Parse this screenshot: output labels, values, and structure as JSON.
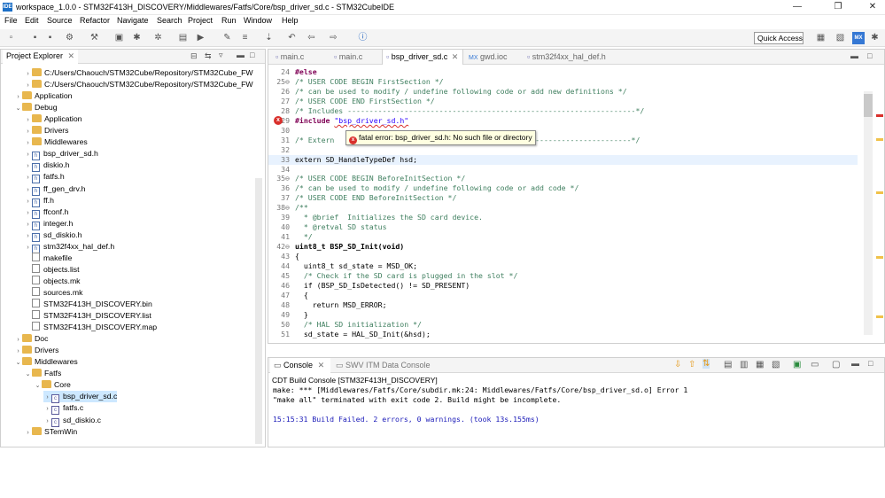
{
  "window": {
    "app_icon": "IDE",
    "title": "workspace_1.0.0 - STM32F413H_DISCOVERY/Middlewares/Fatfs/Core/bsp_driver_sd.c - STM32CubeIDE",
    "minimize": "—",
    "restore": "❐",
    "close": "✕"
  },
  "menu": [
    "File",
    "Edit",
    "Source",
    "Refactor",
    "Navigate",
    "Search",
    "Project",
    "Run",
    "Window",
    "Help"
  ],
  "toolbar": {
    "quick_access": "Quick Access",
    "perspective_mx": "MX"
  },
  "project_explorer": {
    "title": "Project Explorer",
    "tree": [
      {
        "label": "C:/Users/Chaouch/STM32Cube/Repository/STM32Cube_FW",
        "type": "folder",
        "depth": 2,
        "toggle": "›"
      },
      {
        "label": "C:/Users/Chaouch/STM32Cube/Repository/STM32Cube_FW",
        "type": "folder",
        "depth": 2,
        "toggle": "›"
      },
      {
        "label": "Application",
        "type": "folder",
        "depth": 1,
        "toggle": "›"
      },
      {
        "label": "Debug",
        "type": "folder",
        "depth": 1,
        "toggle": "⌄"
      },
      {
        "label": "Application",
        "type": "folder",
        "depth": 2,
        "toggle": "›"
      },
      {
        "label": "Drivers",
        "type": "folder",
        "depth": 2,
        "toggle": "›"
      },
      {
        "label": "Middlewares",
        "type": "folder",
        "depth": 2,
        "toggle": "›"
      },
      {
        "label": "bsp_driver_sd.h",
        "type": "h",
        "depth": 2,
        "toggle": "›"
      },
      {
        "label": "diskio.h",
        "type": "h",
        "depth": 2,
        "toggle": "›"
      },
      {
        "label": "fatfs.h",
        "type": "h",
        "depth": 2,
        "toggle": "›"
      },
      {
        "label": "ff_gen_drv.h",
        "type": "h",
        "depth": 2,
        "toggle": "›"
      },
      {
        "label": "ff.h",
        "type": "h",
        "depth": 2,
        "toggle": "›"
      },
      {
        "label": "ffconf.h",
        "type": "h",
        "depth": 2,
        "toggle": "›"
      },
      {
        "label": "integer.h",
        "type": "h",
        "depth": 2,
        "toggle": "›"
      },
      {
        "label": "sd_diskio.h",
        "type": "h",
        "depth": 2,
        "toggle": "›"
      },
      {
        "label": "stm32f4xx_hal_def.h",
        "type": "h",
        "depth": 2,
        "toggle": "›"
      },
      {
        "label": "makefile",
        "type": "file",
        "depth": 2,
        "toggle": ""
      },
      {
        "label": "objects.list",
        "type": "file",
        "depth": 2,
        "toggle": ""
      },
      {
        "label": "objects.mk",
        "type": "file",
        "depth": 2,
        "toggle": ""
      },
      {
        "label": "sources.mk",
        "type": "file",
        "depth": 2,
        "toggle": ""
      },
      {
        "label": "STM32F413H_DISCOVERY.bin",
        "type": "file",
        "depth": 2,
        "toggle": ""
      },
      {
        "label": "STM32F413H_DISCOVERY.list",
        "type": "file",
        "depth": 2,
        "toggle": ""
      },
      {
        "label": "STM32F413H_DISCOVERY.map",
        "type": "file",
        "depth": 2,
        "toggle": ""
      },
      {
        "label": "Doc",
        "type": "folder",
        "depth": 1,
        "toggle": "›"
      },
      {
        "label": "Drivers",
        "type": "folder",
        "depth": 1,
        "toggle": "›"
      },
      {
        "label": "Middlewares",
        "type": "folder",
        "depth": 1,
        "toggle": "⌄"
      },
      {
        "label": "Fatfs",
        "type": "folder",
        "depth": 2,
        "toggle": "⌄"
      },
      {
        "label": "Core",
        "type": "folder",
        "depth": 3,
        "toggle": "⌄"
      },
      {
        "label": "bsp_driver_sd.c",
        "type": "c",
        "depth": 4,
        "toggle": "›",
        "selected": true
      },
      {
        "label": "fatfs.c",
        "type": "c",
        "depth": 4,
        "toggle": "›"
      },
      {
        "label": "sd_diskio.c",
        "type": "c",
        "depth": 4,
        "toggle": "›"
      },
      {
        "label": "STemWin",
        "type": "folder",
        "depth": 2,
        "toggle": "›"
      }
    ]
  },
  "editor": {
    "tabs": [
      {
        "label": "main.c",
        "active": false
      },
      {
        "label": "main.c",
        "active": false
      },
      {
        "label": "bsp_driver_sd.c",
        "active": true,
        "close": "✕"
      },
      {
        "label": "gwd.ioc",
        "active": false
      },
      {
        "label": "stm32f4xx_hal_def.h",
        "active": false
      }
    ],
    "lines": [
      {
        "n": "24",
        "t": "#else",
        "cls": "kw"
      },
      {
        "n": "25",
        "fold": "⊖",
        "t": "/* USER CODE BEGIN FirstSection */",
        "cls": "cm"
      },
      {
        "n": "26",
        "t": "/* can be used to modify / undefine following code or add new definitions */",
        "cls": "cm"
      },
      {
        "n": "27",
        "t": "/* USER CODE END FirstSection */",
        "cls": "cm"
      },
      {
        "n": "28",
        "t": "/* Includes ------------------------------------------------------------------*/",
        "cls": "cm"
      },
      {
        "n": "29",
        "t": "#include \"bsp_driver_sd.h\"",
        "cls": "str",
        "err": true
      },
      {
        "n": "30",
        "t": "",
        "cls": ""
      },
      {
        "n": "31",
        "t": "/* Extern                                       -----------------------------*/",
        "cls": "cm"
      },
      {
        "n": "32",
        "t": "",
        "cls": ""
      },
      {
        "n": "33",
        "t": "extern SD_HandleTypeDef hsd;",
        "cls": "",
        "current": true
      },
      {
        "n": "34",
        "t": "",
        "cls": ""
      },
      {
        "n": "35",
        "fold": "⊖",
        "t": "/* USER CODE BEGIN BeforeInitSection */",
        "cls": "cm"
      },
      {
        "n": "36",
        "t": "/* can be used to modify / undefine following code or add code */",
        "cls": "cm"
      },
      {
        "n": "37",
        "t": "/* USER CODE END BeforeInitSection */",
        "cls": "cm"
      },
      {
        "n": "38",
        "fold": "⊖",
        "t": "/**",
        "cls": "cm"
      },
      {
        "n": "39",
        "t": "  * @brief  Initializes the SD card device.",
        "cls": "cm"
      },
      {
        "n": "40",
        "t": "  * @retval SD status",
        "cls": "cm"
      },
      {
        "n": "41",
        "t": "  */",
        "cls": "cm"
      },
      {
        "n": "42",
        "fold": "⊖",
        "t": "uint8_t BSP_SD_Init(void)",
        "cls": "fn"
      },
      {
        "n": "43",
        "t": "{",
        "cls": ""
      },
      {
        "n": "44",
        "t": "  uint8_t sd_state = MSD_OK;",
        "cls": ""
      },
      {
        "n": "45",
        "t": "  /* Check if the SD card is plugged in the slot */",
        "cls": "cm"
      },
      {
        "n": "46",
        "t": "  if (BSP_SD_IsDetected() != SD_PRESENT)",
        "cls": ""
      },
      {
        "n": "47",
        "t": "  {",
        "cls": ""
      },
      {
        "n": "48",
        "t": "    return MSD_ERROR;",
        "cls": ""
      },
      {
        "n": "49",
        "t": "  }",
        "cls": ""
      },
      {
        "n": "50",
        "t": "  /* HAL SD initialization */",
        "cls": "cm"
      },
      {
        "n": "51",
        "t": "  sd_state = HAL_SD_Init(&hsd);",
        "cls": ""
      }
    ],
    "error_marker": "x",
    "tooltip": "fatal error: bsp_driver_sd.h: No such file or directory"
  },
  "console": {
    "tabs": [
      {
        "label": "Console",
        "active": true
      },
      {
        "label": "SWV ITM Data Console",
        "active": false
      }
    ],
    "header": "CDT Build Console [STM32F413H_DISCOVERY]",
    "lines": [
      {
        "t": "make: *** [Middlewares/Fatfs/Core/subdir.mk:24: Middlewares/Fatfs/Core/bsp_driver_sd.o] Error 1",
        "color": "#000000"
      },
      {
        "t": "\"make all\" terminated with exit code 2. Build might be incomplete.",
        "color": "#000000"
      },
      {
        "t": "",
        "color": "#000000"
      },
      {
        "t": "15:15:31 Build Failed. 2 errors, 0 warnings. (took 13s.155ms)",
        "color": "#1a1ab8"
      }
    ]
  },
  "colors": {
    "error": "#d9302c",
    "comment": "#3f7f5f",
    "keyword": "#7f0055",
    "string": "#2a00ff",
    "selection": "#cde8ff"
  }
}
